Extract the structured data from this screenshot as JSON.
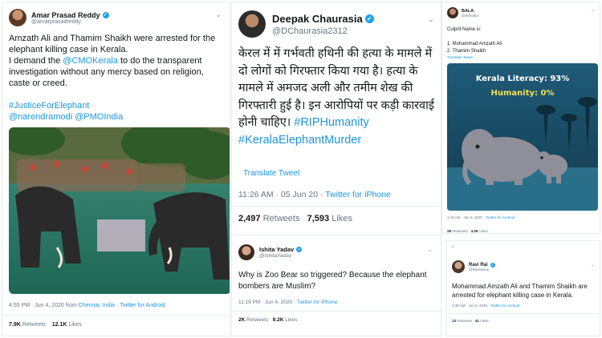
{
  "colors": {
    "link": "#1b95e0",
    "muted": "#657786",
    "verified": "#1da1f2",
    "poster_yellow": "#f4e04d"
  },
  "tweet1": {
    "name": "Amar Prasad Reddy",
    "handle": "@amarprasadreddy",
    "text_before": "Amzath Ali and Thamim Shaikh were arrested for the elephant killing case in Kerala.\nI demand the ",
    "mention_cmo": "@CMOKerala",
    "text_after": " to do the transparent investigation without any mercy based on religion, caste or creed.",
    "hashtag": "#JusticeForElephant",
    "mention_modi": "@narendramodi",
    "mention_pmo": "@PMOIndia",
    "time": "4:55 PM · Jun 4, 2020",
    "from_word": "from",
    "location": "Chennai, India",
    "source": "Twitter for Android",
    "retweets_count": "7.9K",
    "retweets_label": "Retweets",
    "likes_count": "12.1K",
    "likes_label": "Likes"
  },
  "tweet2": {
    "name": "Deepak Chaurasia",
    "handle": "@DChaurasia2312",
    "text": "केरल में में गर्भवती हथिनी की हत्या के मामले में दो लोगों को गिरफ्तार किया गया है। हत्या के मामले में अमजद अली और तमीम शेख की गिरफ्तारी हुई है। इन आरोपियों पर कड़ी कारवाई होनी चाहिए। ",
    "hashtag1": "#RIPHumanity",
    "hashtag2": "#KeralaElephantMurder",
    "translate": "Translate Tweet",
    "time": "11:26 AM · 05 Jun 20 · ",
    "source": "Twitter for iPhone",
    "retweets_count": "2,497",
    "retweets_label": "Retweets",
    "likes_count": "7,593",
    "likes_label": "Likes"
  },
  "reply": {
    "name": "Ishita Yadav",
    "handle": "@IshitaYadav",
    "text": "Why is Zoo Bear so triggered? Because the elephant bombers are Muslim?",
    "time": "11:19 PM · Jun 4, 2020 · ",
    "source": "Twitter for iPhone",
    "retweets_count": "2K",
    "retweets_label": "Retweets",
    "likes_count": "9.2K",
    "likes_label": "Likes"
  },
  "tweet3": {
    "name": "BALA",
    "handle": "@erbmjha",
    "text": "Culprit Name is:\n\n1. Mohammad Amzath Ali\n2. Thamim Shaikh",
    "translate": "Translate Tweet",
    "poster_line1": "Kerala Literacy: 93%",
    "poster_line2": "Humanity: 0%",
    "time": "1:19 AM · Jun 5, 2020 · ",
    "source": "Twitter for Android",
    "retweets_count": "2K",
    "retweets_label": "Retweets",
    "likes_count": "4.2K",
    "likes_label": "Likes"
  },
  "tweet4": {
    "name": "Ravi Rai",
    "handle": "@Ravirairoe",
    "text": "Mohammad Amzath Ali and Thamim Shaikh are arrested for elephant killing case in Kerala.",
    "time": "1:38 AM · Jun 5, 2020 · ",
    "source": "Twitter for Android",
    "retweets_count": "13",
    "retweets_label": "Retweets",
    "likes_count": "41",
    "likes_label": "Likes"
  }
}
